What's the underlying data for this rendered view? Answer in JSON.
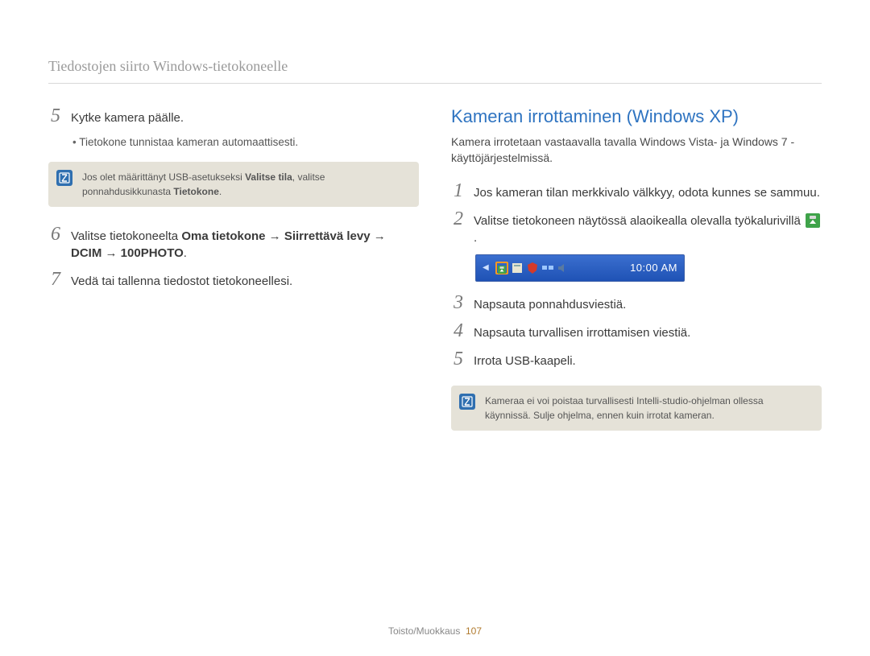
{
  "breadcrumb": "Tiedostojen siirto Windows-tietokoneelle",
  "left": {
    "steps": [
      {
        "num": "5",
        "text": "Kytke kamera päälle."
      },
      {
        "num": "6",
        "text_pre": "Valitse tietokoneelta ",
        "bold": "Oma tietokone → Siirrettävä levy → DCIM → 100PHOTO",
        "text_post": "."
      },
      {
        "num": "7",
        "text": "Vedä tai tallenna tiedostot tietokoneellesi."
      }
    ],
    "sub_bullet": "Tietokone tunnistaa kameran automaattisesti.",
    "note_pre": "Jos olet määrittänyt USB-asetukseksi ",
    "note_b1": "Valitse tila",
    "note_mid": ", valitse ponnahdusikkunasta ",
    "note_b2": "Tietokone",
    "note_post": "."
  },
  "right": {
    "heading": "Kameran irrottaminen (Windows XP)",
    "intro": "Kamera irrotetaan vastaavalla tavalla Windows Vista- ja Windows 7 -käyttöjärjestelmissä.",
    "steps": [
      {
        "num": "1",
        "text": "Jos kameran tilan merkkivalo välkkyy, odota kunnes se sammuu."
      },
      {
        "num": "2",
        "text_pre": "Valitse tietokoneen näytössä alaoikealla olevalla työkalurivillä ",
        "text_post": " ."
      },
      {
        "num": "3",
        "text": "Napsauta ponnahdusviestiä."
      },
      {
        "num": "4",
        "text": "Napsauta turvallisen irrottamisen viestiä."
      },
      {
        "num": "5",
        "text": "Irrota USB-kaapeli."
      }
    ],
    "note": "Kameraa ei voi poistaa turvallisesti Intelli-studio-ohjelman ollessa käynnissä. Sulje ohjelma, ennen kuin irrotat kameran.",
    "tray": {
      "clock": "10:00 AM"
    }
  },
  "footer": {
    "section": "Toisto/Muokkaus",
    "page": "107"
  }
}
